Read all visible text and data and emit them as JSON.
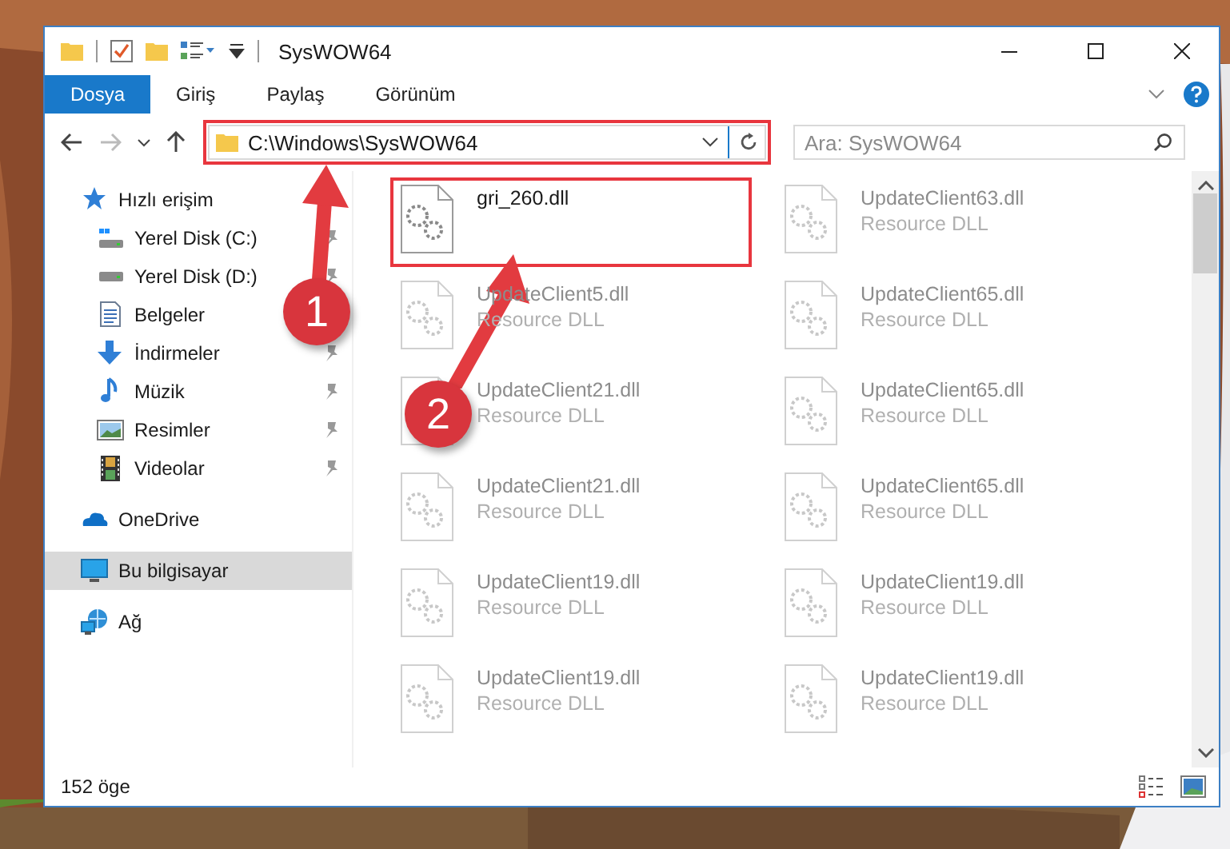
{
  "window": {
    "title": "SysWOW64"
  },
  "ribbon_tabs": [
    {
      "label": "Dosya",
      "selected": true
    },
    {
      "label": "Giriş",
      "selected": false
    },
    {
      "label": "Paylaş",
      "selected": false
    },
    {
      "label": "Görünüm",
      "selected": false
    }
  ],
  "address_bar": {
    "path": "C:\\Windows\\SysWOW64",
    "highlighted": true
  },
  "search": {
    "placeholder": "Ara: SysWOW64"
  },
  "sidebar": {
    "items": [
      {
        "label": "Hızlı erişim",
        "kind": "star",
        "selected": false,
        "children": [
          {
            "label": "Yerel Disk (C:)",
            "kind": "system-drive",
            "pinned": true,
            "selected": false
          },
          {
            "label": "Yerel Disk (D:)",
            "kind": "drive",
            "pinned": true,
            "selected": false
          },
          {
            "label": "Belgeler",
            "kind": "document",
            "pinned": false,
            "selected": false
          },
          {
            "label": "İndirmeler",
            "kind": "download",
            "pinned": true,
            "selected": false
          },
          {
            "label": "Müzik",
            "kind": "music",
            "pinned": true,
            "selected": false
          },
          {
            "label": "Resimler",
            "kind": "pictures",
            "pinned": true,
            "selected": false
          },
          {
            "label": "Videolar",
            "kind": "film",
            "pinned": true,
            "selected": false
          }
        ]
      },
      {
        "label": "OneDrive",
        "kind": "cloud",
        "selected": false
      },
      {
        "label": "Bu bilgisayar",
        "kind": "computer",
        "selected": true
      },
      {
        "label": "Ağ",
        "kind": "network",
        "selected": false
      }
    ]
  },
  "files": [
    {
      "name": "gri_260.dll",
      "dimmed": false,
      "highlighted": true
    },
    {
      "name": "UpdateClient63.dll",
      "type": "Resource DLL",
      "dimmed": true,
      "highlighted": false
    },
    {
      "name": "UpdateClient5.dll",
      "type": "Resource DLL",
      "dimmed": true,
      "highlighted": false
    },
    {
      "name": "UpdateClient65.dll",
      "type": "Resource DLL",
      "dimmed": true,
      "highlighted": false
    },
    {
      "name": "UpdateClient21.dll",
      "type": "Resource DLL",
      "dimmed": true,
      "highlighted": false
    },
    {
      "name": "UpdateClient65.dll",
      "type": "Resource DLL",
      "dimmed": true,
      "highlighted": false
    },
    {
      "name": "UpdateClient21.dll",
      "type": "Resource DLL",
      "dimmed": true,
      "highlighted": false
    },
    {
      "name": "UpdateClient65.dll",
      "type": "Resource DLL",
      "dimmed": true,
      "highlighted": false
    },
    {
      "name": "UpdateClient19.dll",
      "type": "Resource DLL",
      "dimmed": true,
      "highlighted": false
    },
    {
      "name": "UpdateClient19.dll",
      "type": "Resource DLL",
      "dimmed": true,
      "highlighted": false
    },
    {
      "name": "UpdateClient19.dll",
      "type": "Resource DLL",
      "dimmed": true,
      "highlighted": false
    },
    {
      "name": "UpdateClient19.dll",
      "type": "Resource DLL",
      "dimmed": true,
      "highlighted": false
    }
  ],
  "status_bar": {
    "count": "152 öge"
  },
  "callouts": [
    {
      "label": "1"
    },
    {
      "label": "2"
    }
  ]
}
